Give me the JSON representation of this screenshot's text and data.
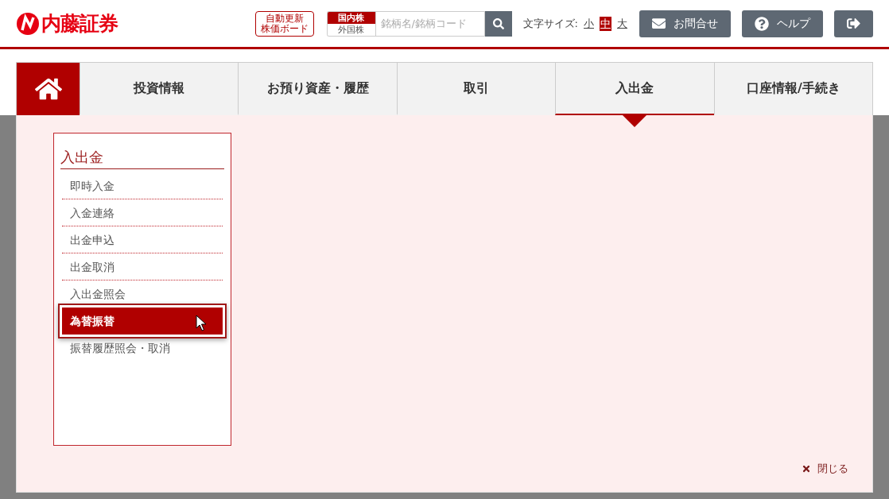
{
  "header": {
    "logo_text": "内藤証券",
    "board_button": [
      "自動更新",
      "株価ボード"
    ],
    "market_options": [
      {
        "label": "国内株",
        "selected": true
      },
      {
        "label": "外国株",
        "selected": false
      }
    ],
    "search": {
      "placeholder": "銘柄名/銘柄コード"
    },
    "font_size": {
      "label": "文字サイズ:",
      "sizes": [
        {
          "label": "小",
          "selected": false
        },
        {
          "label": "中",
          "selected": true
        },
        {
          "label": "大",
          "selected": false
        }
      ]
    },
    "buttons": [
      {
        "kind": "mail",
        "label": "お問合せ"
      },
      {
        "kind": "help",
        "label": "ヘルプ"
      },
      {
        "kind": "logout"
      }
    ]
  },
  "nav": {
    "tabs": [
      {
        "label": "投資情報",
        "selected": false
      },
      {
        "label": "お預り資産・履歴",
        "selected": false
      },
      {
        "label": "取引",
        "selected": false
      },
      {
        "label": "入出金",
        "selected": true
      },
      {
        "label": "口座情報/手続き",
        "selected": false
      }
    ]
  },
  "dropdown": {
    "heading": "入出金",
    "items": [
      {
        "label": "即時入金",
        "selected": false
      },
      {
        "label": "入金連絡",
        "selected": false
      },
      {
        "label": "出金申込",
        "selected": false
      },
      {
        "label": "出金取消",
        "selected": false
      },
      {
        "label": "入出金照会",
        "selected": false
      },
      {
        "label": "為替振替",
        "selected": true
      },
      {
        "label": "振替履歴照会・取消",
        "selected": false
      }
    ],
    "close_label": "閉じる"
  }
}
